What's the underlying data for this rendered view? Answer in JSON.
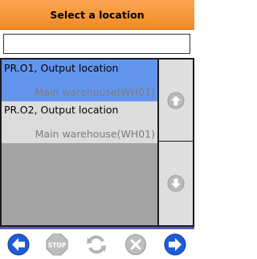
{
  "header": {
    "title": "Select a location"
  },
  "search": {
    "value": "",
    "placeholder": ""
  },
  "locations": [
    {
      "code_desc": "PR.O1, Output location",
      "warehouse": "Main warehouse(WH01)",
      "selected": true
    },
    {
      "code_desc": "PR.O2, Output location",
      "warehouse": "Main warehouse(WH01)",
      "selected": false
    }
  ],
  "scroll": {
    "up_icon": "arrow-up-icon",
    "down_icon": "arrow-down-icon"
  },
  "toolbar": {
    "back_icon": "arrow-left-icon",
    "stop_label": "STOP",
    "refresh_icon": "refresh-icon",
    "cancel_icon": "x-icon",
    "next_icon": "arrow-right-icon"
  },
  "colors": {
    "title_bar": "#f79a3e",
    "selected_row": "#6495ed",
    "row": "#dcdcdc",
    "list_bg": "#a3a3a3",
    "nav_blue": "#1f5bd6",
    "disabled_gray": "#b8b8b8"
  }
}
